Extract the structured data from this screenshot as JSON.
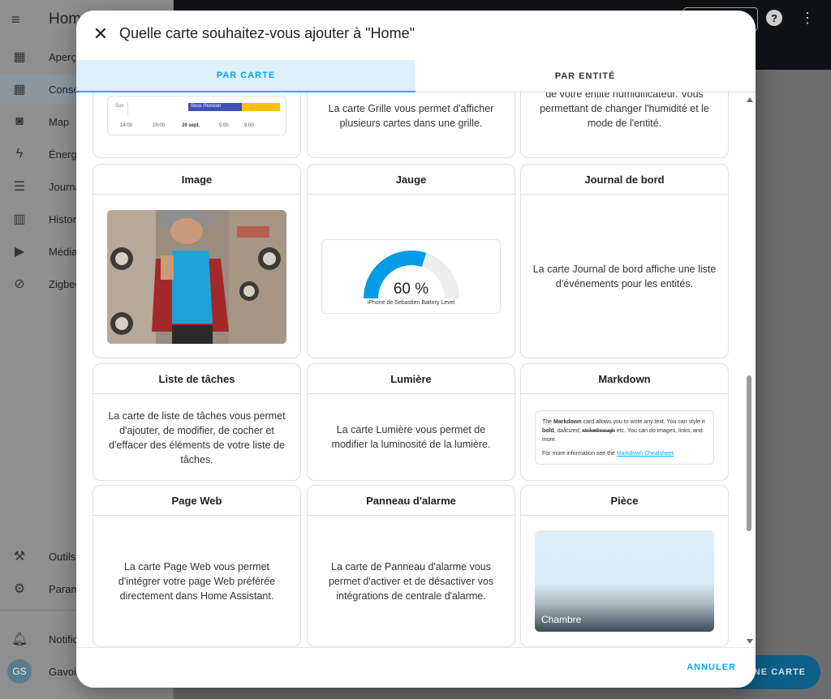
{
  "app": {
    "title": "Home",
    "sidebar_items": [
      {
        "label": "Aperçu",
        "icon": "dashboard-icon"
      },
      {
        "label": "Conso",
        "icon": "dashboard-icon"
      },
      {
        "label": "Map",
        "icon": "map-icon"
      },
      {
        "label": "Énergi",
        "icon": "lightning-icon"
      },
      {
        "label": "Journa",
        "icon": "list-icon"
      },
      {
        "label": "Histori",
        "icon": "chart-icon"
      },
      {
        "label": "Média",
        "icon": "media-icon"
      },
      {
        "label": "Zigbee",
        "icon": "zigbee-icon"
      }
    ],
    "sidebar_bottom": [
      {
        "label": "Outils",
        "icon": "hammer-icon"
      },
      {
        "label": "Param",
        "icon": "gear-icon"
      }
    ],
    "notifications_label": "Notific",
    "user_label": "Gavois",
    "user_initials": "GS",
    "fab_label": "UNE CARTE"
  },
  "dialog": {
    "title": "Quelle carte souhaitez-vous ajouter à \"Home\"",
    "tabs": [
      "PAR CARTE",
      "PAR ENTITÉ"
    ],
    "active_tab": 0,
    "cancel_label": "ANNULER"
  },
  "top_partial": {
    "timeline": {
      "row_label": "Sun",
      "bar_label": "Sous l'horizon",
      "ticks": [
        "14:00",
        "19:00",
        "20 sept.",
        "5:00",
        "9:00"
      ]
    },
    "grid_desc": "La carte Grille vous permet d'afficher plusieurs cartes dans une grille.",
    "humidifier_desc": "La carte Humidificateur donne le contrôle de votre entité humidificateur. Vous permettant de changer l'humidité et le mode de l'entité."
  },
  "cards": [
    {
      "title": "Image"
    },
    {
      "title": "Jauge",
      "gauge": {
        "value_text": "60 %",
        "value": 0.6,
        "label": "iPhone de Sebastien Battery Level"
      }
    },
    {
      "title": "Journal de bord",
      "desc": "La carte Journal de bord affiche une liste d'événements pour les entités."
    },
    {
      "title": "Liste de tâches",
      "desc": "La carte de liste de tâches vous permet d'ajouter, de modifier, de cocher et d'effacer des éléments de votre liste de tâches."
    },
    {
      "title": "Lumière",
      "desc": "La carte Lumière vous permet de modifier la luminosité de la lumière."
    },
    {
      "title": "Markdown",
      "md": {
        "line1a": "The ",
        "line1b": "Markdown",
        "line1c": " card allows you to write any text. You can style it ",
        "bold": "bold",
        "sep1": ", ",
        "italic": "italicized",
        "sep2": ", ",
        "strike": "strikethrough",
        "tail": " etc. You can do images, links, and more.",
        "line2": "For more information see the ",
        "link": "Markdown Cheatsheet",
        "end": "."
      }
    },
    {
      "title": "Page Web",
      "desc": "La carte Page Web vous permet d'intégrer votre page Web préférée directement dans Home Assistant."
    },
    {
      "title": "Panneau d'alarme",
      "desc": "La carte de Panneau d'alarme vous permet d'activer et de désactiver vos intégrations de centrale d'alarme."
    },
    {
      "title": "Pièce",
      "room_label": "Chambre"
    }
  ],
  "colors": {
    "accent": "#03a9f4",
    "timeline_blue": "#3f51b5",
    "timeline_amber": "#ffc107",
    "gauge_fill": "#039be5",
    "gauge_track": "#eeeeee"
  }
}
